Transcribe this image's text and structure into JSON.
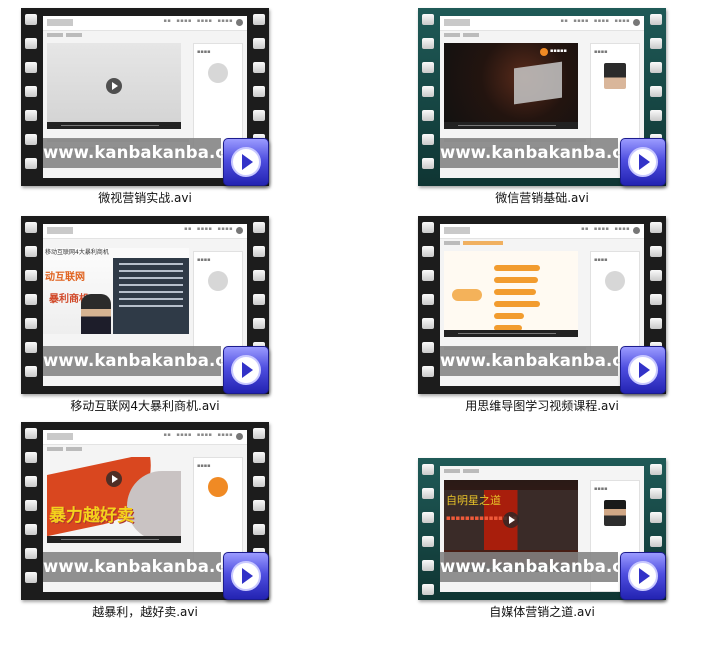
{
  "watermark_text": "www.kanbakanba.cn",
  "videos": [
    {
      "filename": "微视营销实战.avi",
      "label": ""
    },
    {
      "filename": "微信营销基础.avi",
      "label": ""
    },
    {
      "filename": "移动互联网4大暴利商机.avi",
      "label": "移动互联网4大暴利商机",
      "slide_line1": "动互联网",
      "slide_line2": "暴利商机"
    },
    {
      "filename": "用思维导图学习视频课程.avi",
      "label": ""
    },
    {
      "filename": "越暴利，越好卖.avi",
      "label": "",
      "slogan": "暴力越好卖"
    },
    {
      "filename": "自媒体营销之道.avi",
      "label": "",
      "slide_line1": "自明星之道"
    }
  ]
}
